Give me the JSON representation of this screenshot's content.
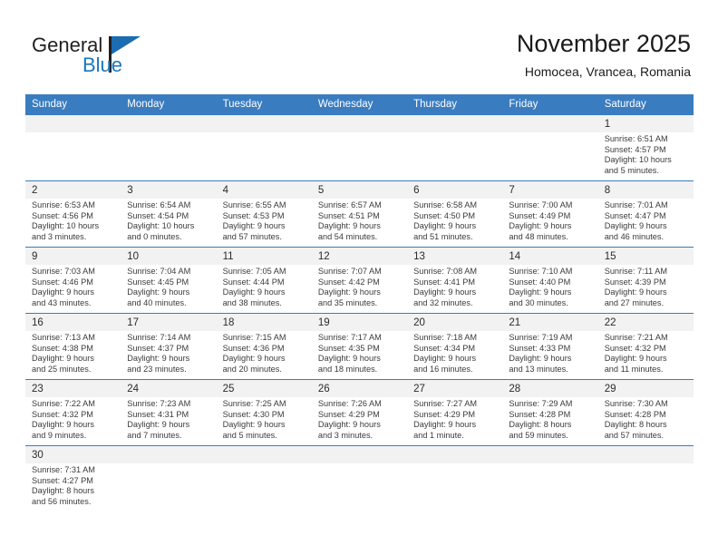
{
  "logo": {
    "word_top": "General",
    "word_bottom": "Blue",
    "triangle_color": "#1b6cb0",
    "blue_text_color": "#1b76bc"
  },
  "header": {
    "title": "November 2025",
    "subtitle": "Homocea, Vrancea, Romania"
  },
  "theme": {
    "header_row_bg": "#3a7cc0",
    "daynum_bg": "#f2f2f2",
    "grid_line": "#3a7cc0"
  },
  "weekday_headers": [
    "Sunday",
    "Monday",
    "Tuesday",
    "Wednesday",
    "Thursday",
    "Friday",
    "Saturday"
  ],
  "weeks": [
    [
      {
        "day": "",
        "blank": true
      },
      {
        "day": "",
        "blank": true
      },
      {
        "day": "",
        "blank": true
      },
      {
        "day": "",
        "blank": true
      },
      {
        "day": "",
        "blank": true
      },
      {
        "day": "",
        "blank": true
      },
      {
        "day": "1",
        "sunrise": "Sunrise: 6:51 AM",
        "sunset": "Sunset: 4:57 PM",
        "daylight1": "Daylight: 10 hours",
        "daylight2": "and 5 minutes."
      }
    ],
    [
      {
        "day": "2",
        "sunrise": "Sunrise: 6:53 AM",
        "sunset": "Sunset: 4:56 PM",
        "daylight1": "Daylight: 10 hours",
        "daylight2": "and 3 minutes."
      },
      {
        "day": "3",
        "sunrise": "Sunrise: 6:54 AM",
        "sunset": "Sunset: 4:54 PM",
        "daylight1": "Daylight: 10 hours",
        "daylight2": "and 0 minutes."
      },
      {
        "day": "4",
        "sunrise": "Sunrise: 6:55 AM",
        "sunset": "Sunset: 4:53 PM",
        "daylight1": "Daylight: 9 hours",
        "daylight2": "and 57 minutes."
      },
      {
        "day": "5",
        "sunrise": "Sunrise: 6:57 AM",
        "sunset": "Sunset: 4:51 PM",
        "daylight1": "Daylight: 9 hours",
        "daylight2": "and 54 minutes."
      },
      {
        "day": "6",
        "sunrise": "Sunrise: 6:58 AM",
        "sunset": "Sunset: 4:50 PM",
        "daylight1": "Daylight: 9 hours",
        "daylight2": "and 51 minutes."
      },
      {
        "day": "7",
        "sunrise": "Sunrise: 7:00 AM",
        "sunset": "Sunset: 4:49 PM",
        "daylight1": "Daylight: 9 hours",
        "daylight2": "and 48 minutes."
      },
      {
        "day": "8",
        "sunrise": "Sunrise: 7:01 AM",
        "sunset": "Sunset: 4:47 PM",
        "daylight1": "Daylight: 9 hours",
        "daylight2": "and 46 minutes."
      }
    ],
    [
      {
        "day": "9",
        "sunrise": "Sunrise: 7:03 AM",
        "sunset": "Sunset: 4:46 PM",
        "daylight1": "Daylight: 9 hours",
        "daylight2": "and 43 minutes."
      },
      {
        "day": "10",
        "sunrise": "Sunrise: 7:04 AM",
        "sunset": "Sunset: 4:45 PM",
        "daylight1": "Daylight: 9 hours",
        "daylight2": "and 40 minutes."
      },
      {
        "day": "11",
        "sunrise": "Sunrise: 7:05 AM",
        "sunset": "Sunset: 4:44 PM",
        "daylight1": "Daylight: 9 hours",
        "daylight2": "and 38 minutes."
      },
      {
        "day": "12",
        "sunrise": "Sunrise: 7:07 AM",
        "sunset": "Sunset: 4:42 PM",
        "daylight1": "Daylight: 9 hours",
        "daylight2": "and 35 minutes."
      },
      {
        "day": "13",
        "sunrise": "Sunrise: 7:08 AM",
        "sunset": "Sunset: 4:41 PM",
        "daylight1": "Daylight: 9 hours",
        "daylight2": "and 32 minutes."
      },
      {
        "day": "14",
        "sunrise": "Sunrise: 7:10 AM",
        "sunset": "Sunset: 4:40 PM",
        "daylight1": "Daylight: 9 hours",
        "daylight2": "and 30 minutes."
      },
      {
        "day": "15",
        "sunrise": "Sunrise: 7:11 AM",
        "sunset": "Sunset: 4:39 PM",
        "daylight1": "Daylight: 9 hours",
        "daylight2": "and 27 minutes."
      }
    ],
    [
      {
        "day": "16",
        "sunrise": "Sunrise: 7:13 AM",
        "sunset": "Sunset: 4:38 PM",
        "daylight1": "Daylight: 9 hours",
        "daylight2": "and 25 minutes."
      },
      {
        "day": "17",
        "sunrise": "Sunrise: 7:14 AM",
        "sunset": "Sunset: 4:37 PM",
        "daylight1": "Daylight: 9 hours",
        "daylight2": "and 23 minutes."
      },
      {
        "day": "18",
        "sunrise": "Sunrise: 7:15 AM",
        "sunset": "Sunset: 4:36 PM",
        "daylight1": "Daylight: 9 hours",
        "daylight2": "and 20 minutes."
      },
      {
        "day": "19",
        "sunrise": "Sunrise: 7:17 AM",
        "sunset": "Sunset: 4:35 PM",
        "daylight1": "Daylight: 9 hours",
        "daylight2": "and 18 minutes."
      },
      {
        "day": "20",
        "sunrise": "Sunrise: 7:18 AM",
        "sunset": "Sunset: 4:34 PM",
        "daylight1": "Daylight: 9 hours",
        "daylight2": "and 16 minutes."
      },
      {
        "day": "21",
        "sunrise": "Sunrise: 7:19 AM",
        "sunset": "Sunset: 4:33 PM",
        "daylight1": "Daylight: 9 hours",
        "daylight2": "and 13 minutes."
      },
      {
        "day": "22",
        "sunrise": "Sunrise: 7:21 AM",
        "sunset": "Sunset: 4:32 PM",
        "daylight1": "Daylight: 9 hours",
        "daylight2": "and 11 minutes."
      }
    ],
    [
      {
        "day": "23",
        "sunrise": "Sunrise: 7:22 AM",
        "sunset": "Sunset: 4:32 PM",
        "daylight1": "Daylight: 9 hours",
        "daylight2": "and 9 minutes."
      },
      {
        "day": "24",
        "sunrise": "Sunrise: 7:23 AM",
        "sunset": "Sunset: 4:31 PM",
        "daylight1": "Daylight: 9 hours",
        "daylight2": "and 7 minutes."
      },
      {
        "day": "25",
        "sunrise": "Sunrise: 7:25 AM",
        "sunset": "Sunset: 4:30 PM",
        "daylight1": "Daylight: 9 hours",
        "daylight2": "and 5 minutes."
      },
      {
        "day": "26",
        "sunrise": "Sunrise: 7:26 AM",
        "sunset": "Sunset: 4:29 PM",
        "daylight1": "Daylight: 9 hours",
        "daylight2": "and 3 minutes."
      },
      {
        "day": "27",
        "sunrise": "Sunrise: 7:27 AM",
        "sunset": "Sunset: 4:29 PM",
        "daylight1": "Daylight: 9 hours",
        "daylight2": "and 1 minute."
      },
      {
        "day": "28",
        "sunrise": "Sunrise: 7:29 AM",
        "sunset": "Sunset: 4:28 PM",
        "daylight1": "Daylight: 8 hours",
        "daylight2": "and 59 minutes."
      },
      {
        "day": "29",
        "sunrise": "Sunrise: 7:30 AM",
        "sunset": "Sunset: 4:28 PM",
        "daylight1": "Daylight: 8 hours",
        "daylight2": "and 57 minutes."
      }
    ],
    [
      {
        "day": "30",
        "sunrise": "Sunrise: 7:31 AM",
        "sunset": "Sunset: 4:27 PM",
        "daylight1": "Daylight: 8 hours",
        "daylight2": "and 56 minutes."
      },
      {
        "day": "",
        "blank": true
      },
      {
        "day": "",
        "blank": true
      },
      {
        "day": "",
        "blank": true
      },
      {
        "day": "",
        "blank": true
      },
      {
        "day": "",
        "blank": true
      },
      {
        "day": "",
        "blank": true
      }
    ]
  ]
}
